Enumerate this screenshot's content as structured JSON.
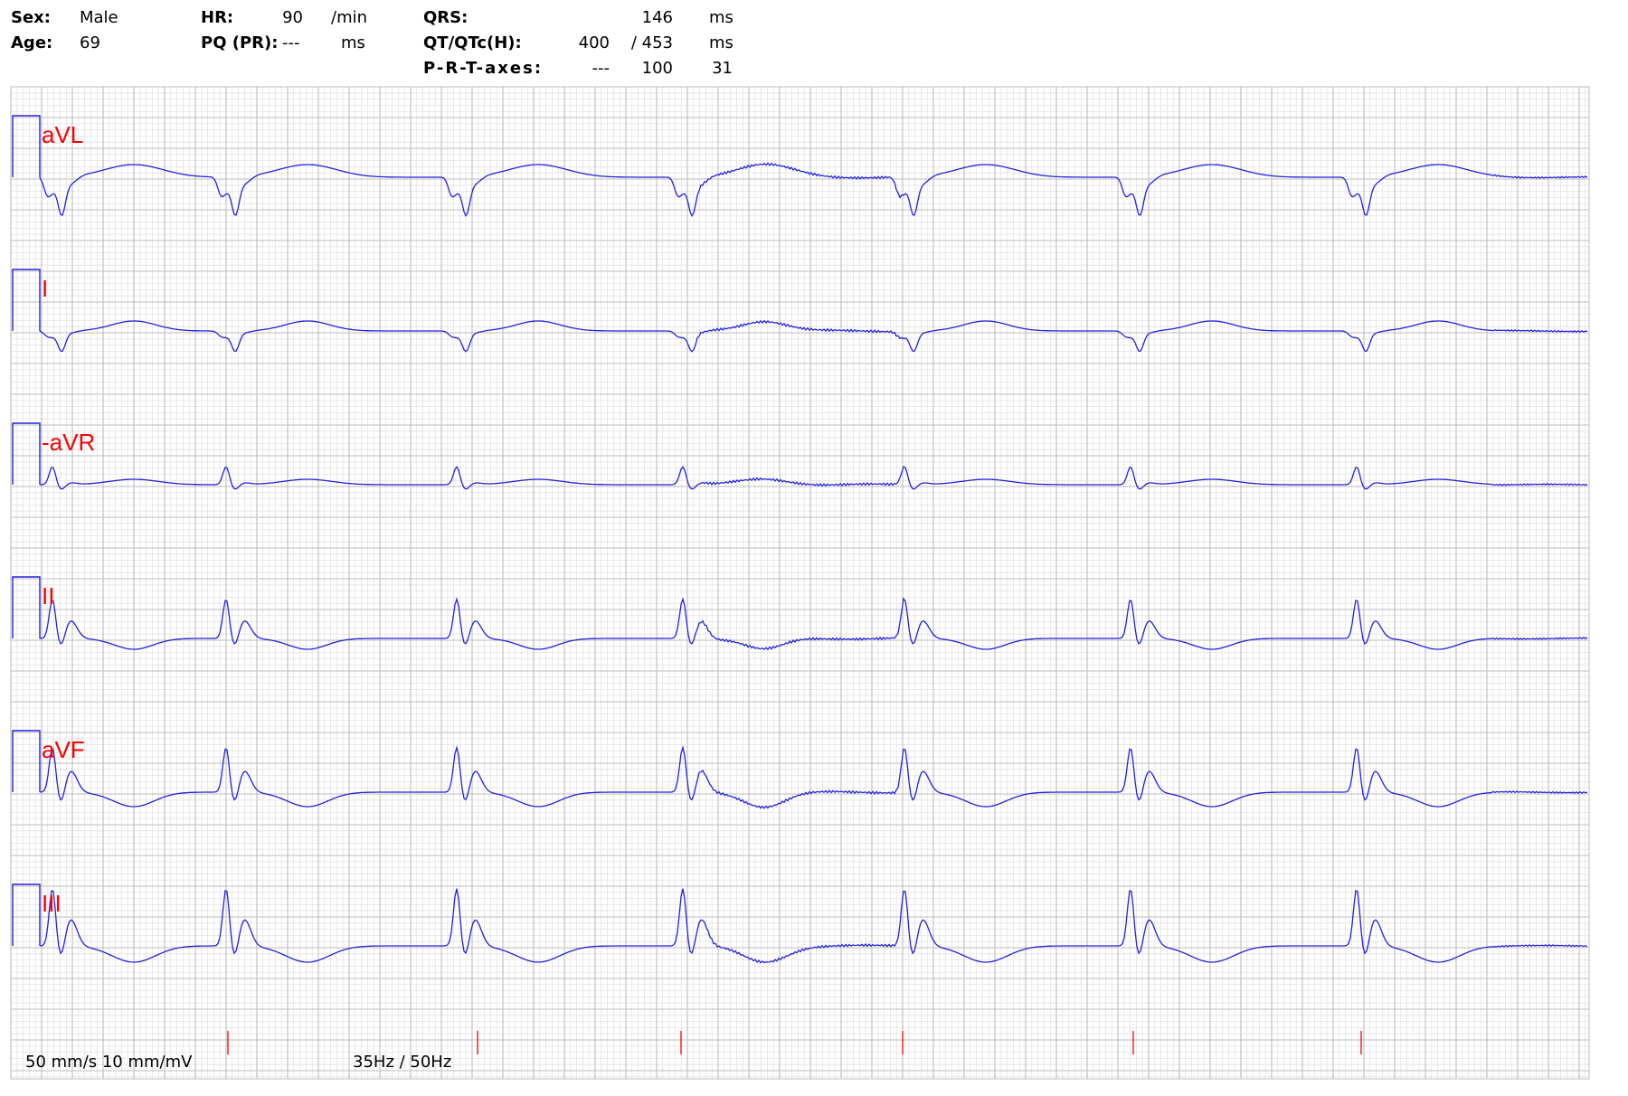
{
  "patient": {
    "sex_label": "Sex:",
    "sex": "Male",
    "age_label": "Age:",
    "age": "69"
  },
  "measurements": {
    "hr_label": "HR:",
    "hr": "90",
    "hr_unit": "/min",
    "pq_label": "PQ (PR):",
    "pq": "---",
    "pq_unit": "ms",
    "qrs_label": "QRS:",
    "qrs": "146",
    "qrs_unit": "ms",
    "qt_label": "QT/QTc(H):",
    "qt": "400",
    "qtc": "/ 453",
    "qt_unit": "ms",
    "axes_label": "P-R-T-axes:",
    "axis_p": "---",
    "axis_r": "100",
    "axis_t": "31"
  },
  "leads": [
    "aVL",
    "I",
    "-aVR",
    "II",
    "aVF",
    "III"
  ],
  "footer": {
    "speed": "50 mm/s 10 mm/mV",
    "filter": "35Hz / 50Hz"
  },
  "colors": {
    "trace": "#2222dd",
    "label": "#ff0000",
    "grid_minor": "#e3e3e3",
    "grid_major": "#bdbdbd",
    "marker": "#ff0000"
  }
}
